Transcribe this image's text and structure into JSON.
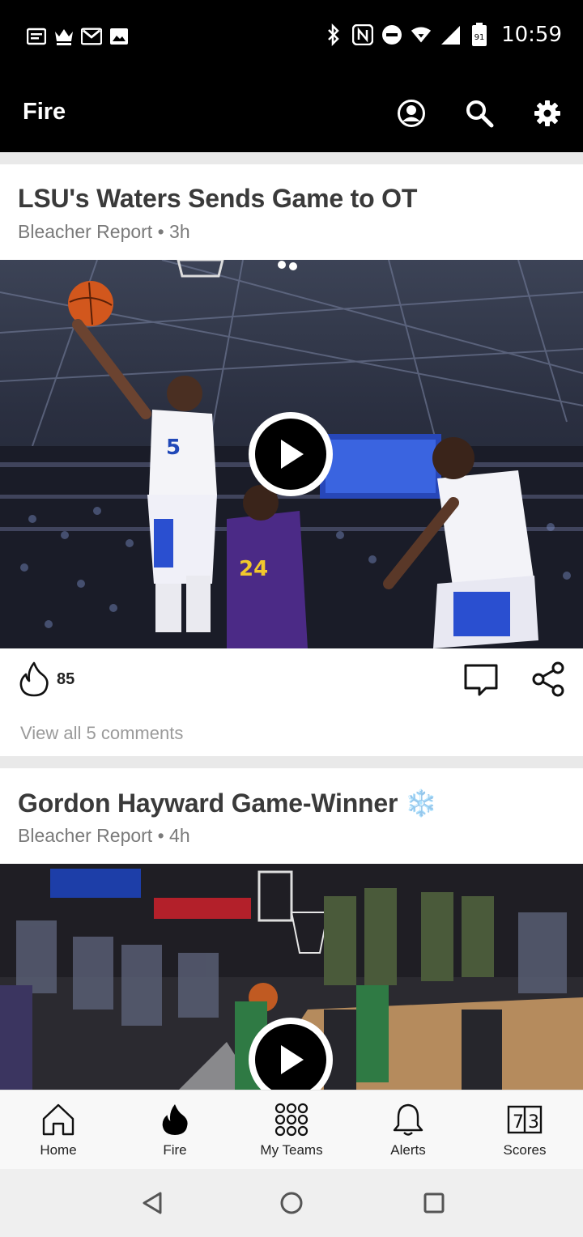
{
  "status_bar": {
    "time": "10:59",
    "battery_level": "91",
    "left_icons": [
      "notes-icon",
      "crown-icon",
      "gmail-icon",
      "image-icon"
    ],
    "right_icons": [
      "bluetooth-icon",
      "nfc-icon",
      "do-not-disturb-icon",
      "wifi-icon",
      "signal-icon",
      "battery-icon"
    ]
  },
  "app_bar": {
    "title": "Fire",
    "actions": [
      "account-icon",
      "search-icon",
      "settings-icon"
    ]
  },
  "feed": {
    "cards": [
      {
        "title": "LSU's Waters Sends Game to OT",
        "source": "Bleacher Report",
        "age": "3h",
        "fire_count": "85",
        "view_comments": "View all 5 comments"
      },
      {
        "title": "Gordon Hayward Game-Winner",
        "title_emoji": "❄️",
        "source": "Bleacher Report",
        "age": "4h"
      }
    ]
  },
  "bottom_nav": {
    "items": [
      {
        "label": "Home",
        "icon": "home-icon",
        "active": false
      },
      {
        "label": "Fire",
        "icon": "fire-icon",
        "active": true
      },
      {
        "label": "My Teams",
        "icon": "teams-grid-icon",
        "active": false
      },
      {
        "label": "Alerts",
        "icon": "bell-icon",
        "active": false
      },
      {
        "label": "Scores",
        "icon": "scoreboard-icon",
        "active": false
      }
    ]
  },
  "colors": {
    "header_bg": "#000000",
    "title_text": "#3a3a3a",
    "meta_text": "#7a7a7a"
  }
}
